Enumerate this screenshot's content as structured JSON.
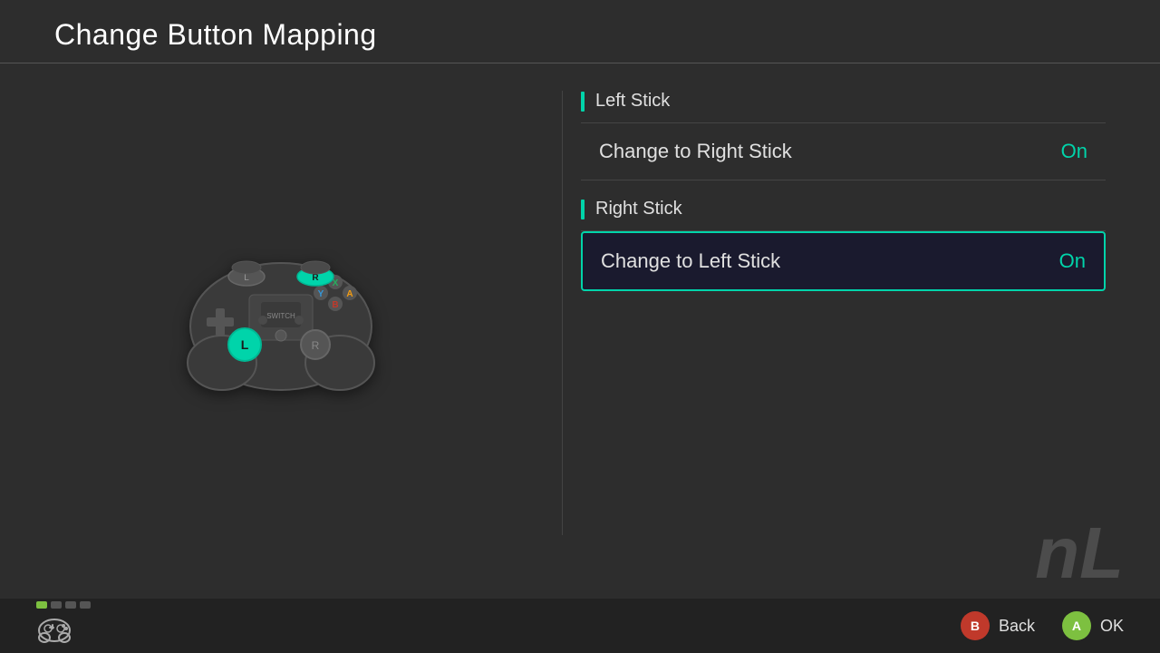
{
  "header": {
    "title": "Change Button Mapping"
  },
  "sections": [
    {
      "id": "left-stick",
      "title": "Left Stick",
      "settings": [
        {
          "label": "Change to Right Stick",
          "value": "On",
          "selected": false
        }
      ]
    },
    {
      "id": "right-stick",
      "title": "Right Stick",
      "settings": [
        {
          "label": "Change to Left Stick",
          "value": "On",
          "selected": true
        }
      ]
    }
  ],
  "bottom_bar": {
    "back_label": "Back",
    "ok_label": "OK",
    "back_button": "B",
    "ok_button": "A"
  },
  "indicators": {
    "dots": [
      "active",
      "inactive",
      "inactive",
      "inactive"
    ]
  },
  "watermark": "nL"
}
